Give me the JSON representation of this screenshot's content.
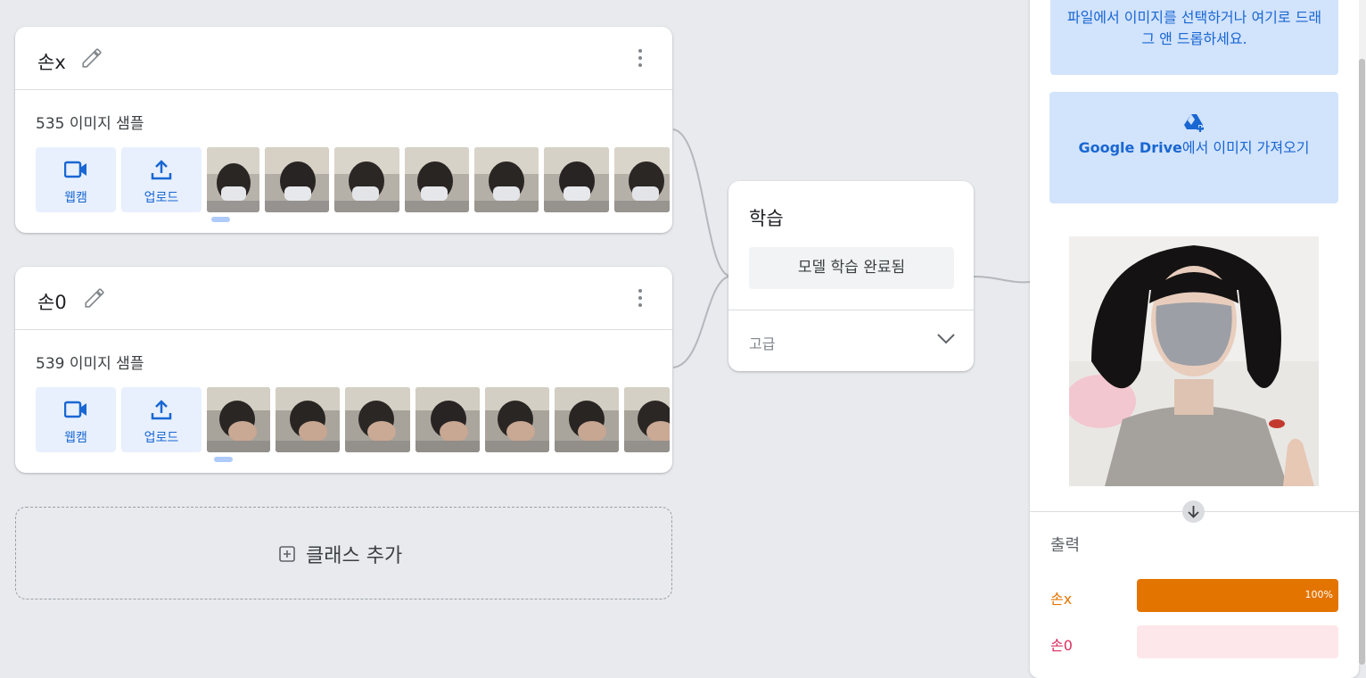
{
  "classes": [
    {
      "name": "손x",
      "sample_count": "535",
      "sample_label": "이미지 샘플",
      "webcam_label": "웹캠",
      "upload_label": "업로드"
    },
    {
      "name": "손0",
      "sample_count": "539",
      "sample_label": "이미지 샘플",
      "webcam_label": "웹캠",
      "upload_label": "업로드"
    }
  ],
  "add_class_label": "클래스 추가",
  "training": {
    "title": "학습",
    "button_label": "모델 학습 완료됨",
    "advanced_label": "고급"
  },
  "preview": {
    "file_drop_text": "파일에서 이미지를 선택하거나 여기로 드래그 앤 드롭하세요.",
    "drive_brand": "Google Drive",
    "drive_text": "에서 이미지 가져오기",
    "output_title": "출력",
    "outputs": [
      {
        "label": "손x",
        "percent": 100,
        "percent_text": "100%",
        "color": "#e37400",
        "track": "#fce8d5"
      },
      {
        "label": "손0",
        "percent": 0,
        "percent_text": "",
        "color": "#d93060",
        "track": "#fde7ea"
      }
    ]
  },
  "colors": {
    "accent": "#1967d2",
    "background": "#e8eaed"
  },
  "icons": [
    "pencil-icon",
    "more-vert-icon",
    "webcam-icon",
    "upload-icon",
    "add-box-icon",
    "chevron-down-icon",
    "drive-add-icon",
    "arrow-down-icon"
  ]
}
